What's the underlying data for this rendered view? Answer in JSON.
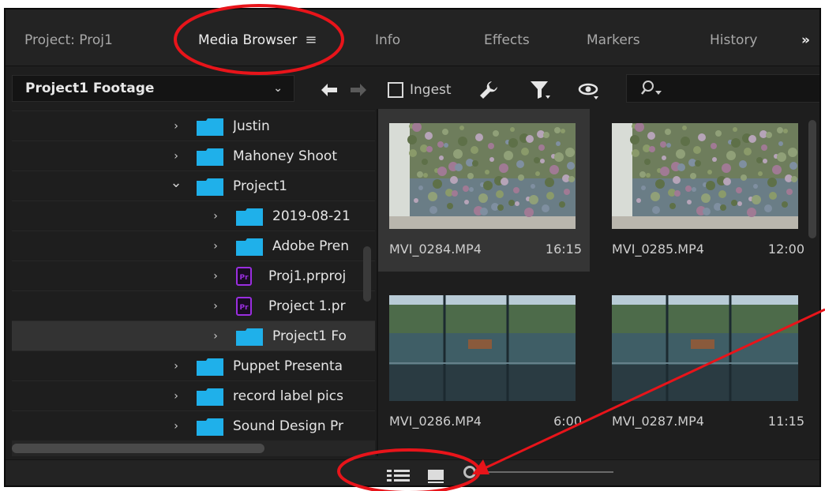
{
  "tabs": [
    {
      "label": "Project: Proj1",
      "active": false
    },
    {
      "label": "Media Browser",
      "active": true,
      "menu_icon": "hamburger-menu-icon"
    },
    {
      "label": "Info",
      "active": false
    },
    {
      "label": "Effects",
      "active": false
    },
    {
      "label": "Markers",
      "active": false
    },
    {
      "label": "History",
      "active": false
    }
  ],
  "overflow_tabs_label": "»",
  "toolbar": {
    "source": "Project1 Footage",
    "back_icon": "arrow-left-icon",
    "forward_icon": "arrow-right-icon",
    "ingest_label": "Ingest",
    "ingest_checked": false,
    "settings_icon": "wrench-icon",
    "filter_icon": "filter-icon",
    "view_icon": "eye-icon",
    "search_icon": "search-icon",
    "search_value": ""
  },
  "tree": [
    {
      "label": "Justin",
      "type": "folder",
      "expanded": false,
      "level": 0
    },
    {
      "label": "Mahoney Shoot",
      "type": "folder",
      "expanded": false,
      "level": 0
    },
    {
      "label": "Project1",
      "type": "folder",
      "expanded": true,
      "level": 0
    },
    {
      "label": "2019-08-21",
      "type": "folder",
      "expanded": false,
      "level": 1
    },
    {
      "label": "Adobe Pren",
      "type": "folder",
      "expanded": false,
      "level": 1
    },
    {
      "label": "Proj1.prproj",
      "type": "premiere-file",
      "expanded": false,
      "level": 1
    },
    {
      "label": "Project 1.pr",
      "type": "premiere-file",
      "expanded": false,
      "level": 1
    },
    {
      "label": "Project1 Fo",
      "type": "folder",
      "expanded": false,
      "level": 1,
      "selected": true
    },
    {
      "label": "Puppet Presenta",
      "type": "folder",
      "expanded": false,
      "level": 0
    },
    {
      "label": "record label pics",
      "type": "folder",
      "expanded": false,
      "level": 0
    },
    {
      "label": "Sound Design Pr",
      "type": "folder",
      "expanded": false,
      "level": 0
    }
  ],
  "clips": [
    {
      "name": "MVI_0284.MP4",
      "duration": "16:15",
      "selected": true,
      "scene": "plant-wall"
    },
    {
      "name": "MVI_0285.MP4",
      "duration": "12:00",
      "selected": false,
      "scene": "plant-wall"
    },
    {
      "name": "MVI_0286.MP4",
      "duration": "6:00",
      "selected": false,
      "scene": "glass-wall"
    },
    {
      "name": "MVI_0287.MP4",
      "duration": "11:15",
      "selected": false,
      "scene": "glass-wall"
    }
  ],
  "bottombar": {
    "list_view_icon": "list-view-icon",
    "icon_view_icon": "icon-view-icon",
    "zoom_knob_icon": "zoom-slider-knob-icon",
    "zoom_level": 0
  },
  "colors": {
    "folder": "#1fb0ea",
    "premiere": "#9a2ee0",
    "annotation": "#e8141a"
  }
}
